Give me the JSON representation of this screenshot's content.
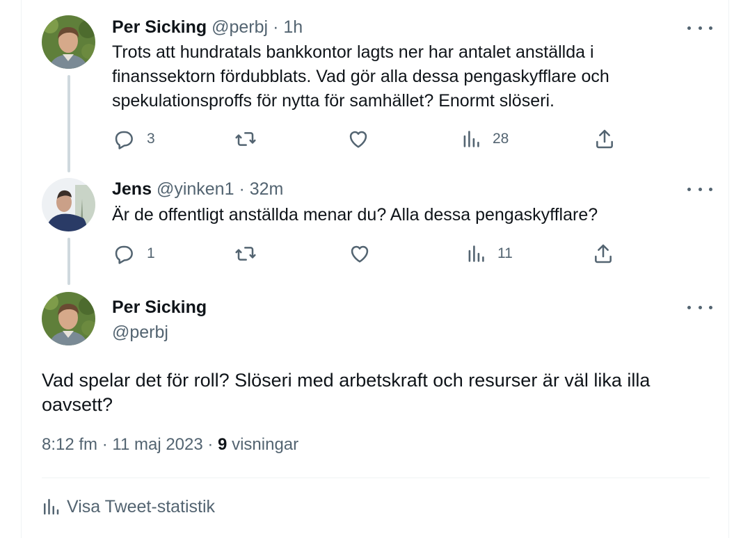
{
  "tweets": [
    {
      "name": "Per Sicking",
      "handle": "@perbj",
      "time": "· 1h",
      "text": "Trots att hundratals bankkontor lagts ner har antalet anställda i finanssektorn fördubblats. Vad gör alla dessa pengaskyfflare och spekulationsproffs för nytta för samhället? Enormt slöseri.",
      "replies": "3",
      "views": "28"
    },
    {
      "name": "Jens",
      "handle": "@yinken1",
      "time": "· 32m",
      "text": "Är de offentligt anställda menar du? Alla dessa pengaskyfflare?",
      "replies": "1",
      "views": "11"
    }
  ],
  "main_tweet": {
    "name": "Per Sicking",
    "handle": "@perbj",
    "text": "Vad spelar det för roll? Slöseri med arbetskraft och resurser är väl lika illa oavsett?",
    "time": "8:12 fm",
    "date": "11 maj 2023",
    "views_count": "9",
    "views_label": "visningar",
    "stats_link": "Visa Tweet-statistik"
  },
  "colors": {
    "text": "#0f1419",
    "muted": "#536471",
    "thread_line": "#cfd9de",
    "divider": "#eff3f4"
  },
  "icons": [
    "reply-icon",
    "retweet-icon",
    "like-icon",
    "views-icon",
    "share-icon",
    "more-icon"
  ]
}
